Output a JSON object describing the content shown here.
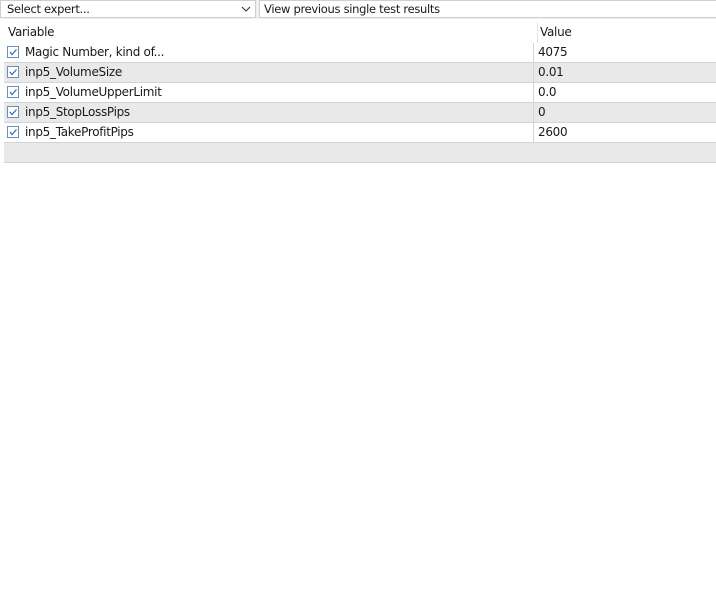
{
  "toolbar": {
    "expert_select_value": "Select expert...",
    "chevron_icon": "chevron-down-icon",
    "view_previous_label": "View previous single test results"
  },
  "table": {
    "columns": {
      "variable": "Variable",
      "value": "Value"
    },
    "rows": [
      {
        "checked": true,
        "variable": "Magic Number, kind of...",
        "value": "4075"
      },
      {
        "checked": true,
        "variable": "inp5_VolumeSize",
        "value": "0.01"
      },
      {
        "checked": true,
        "variable": "inp5_VolumeUpperLimit",
        "value": "0.0"
      },
      {
        "checked": true,
        "variable": "inp5_StopLossPips",
        "value": "0"
      },
      {
        "checked": true,
        "variable": "inp5_TakeProfitPips",
        "value": "2600"
      }
    ]
  },
  "colors": {
    "checkbox_border": "#6c8ebf",
    "checkmark": "#3c6db3",
    "alt_row": "#e9e9e9"
  }
}
